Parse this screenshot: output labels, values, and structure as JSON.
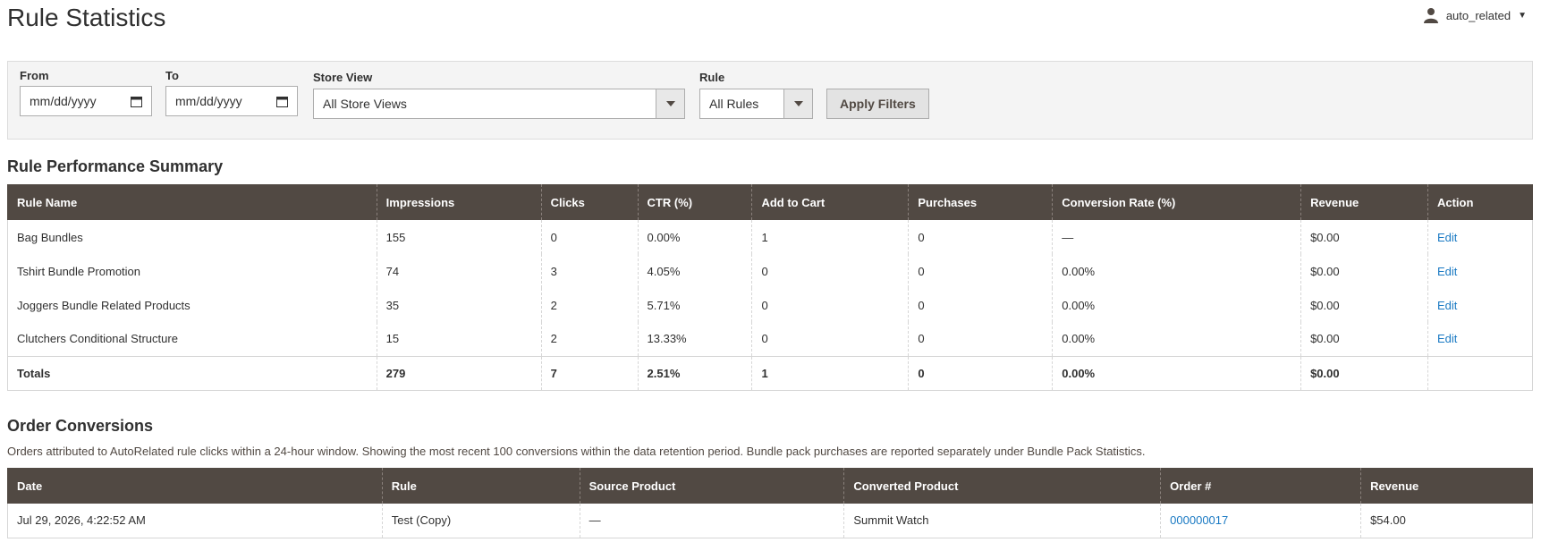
{
  "header": {
    "title": "Rule Statistics",
    "account": {
      "username": "auto_related",
      "icon": "user-icon"
    }
  },
  "filters": {
    "from": {
      "label": "From",
      "placeholder": "mm/dd/yyyy"
    },
    "to": {
      "label": "To",
      "placeholder": "mm/dd/yyyy"
    },
    "store_view": {
      "label": "Store View",
      "value": "All Store Views"
    },
    "rule": {
      "label": "Rule",
      "value": "All Rules"
    },
    "apply_label": "Apply Filters"
  },
  "summary": {
    "title": "Rule Performance Summary",
    "columns": [
      "Rule Name",
      "Impressions",
      "Clicks",
      "CTR (%)",
      "Add to Cart",
      "Purchases",
      "Conversion Rate (%)",
      "Revenue",
      "Action"
    ],
    "rows": [
      {
        "name": "Bag Bundles",
        "impressions": "155",
        "clicks": "0",
        "ctr": "0.00%",
        "add_to_cart": "1",
        "purchases": "0",
        "conversion": "—",
        "revenue": "$0.00",
        "action": "Edit"
      },
      {
        "name": "Tshirt Bundle Promotion",
        "impressions": "74",
        "clicks": "3",
        "ctr": "4.05%",
        "add_to_cart": "0",
        "purchases": "0",
        "conversion": "0.00%",
        "revenue": "$0.00",
        "action": "Edit"
      },
      {
        "name": "Joggers Bundle Related Products",
        "impressions": "35",
        "clicks": "2",
        "ctr": "5.71%",
        "add_to_cart": "0",
        "purchases": "0",
        "conversion": "0.00%",
        "revenue": "$0.00",
        "action": "Edit"
      },
      {
        "name": "Clutchers Conditional Structure",
        "impressions": "15",
        "clicks": "2",
        "ctr": "13.33%",
        "add_to_cart": "0",
        "purchases": "0",
        "conversion": "0.00%",
        "revenue": "$0.00",
        "action": "Edit"
      }
    ],
    "totals": {
      "label": "Totals",
      "impressions": "279",
      "clicks": "7",
      "ctr": "2.51%",
      "add_to_cart": "1",
      "purchases": "0",
      "conversion": "0.00%",
      "revenue": "$0.00"
    }
  },
  "conversions": {
    "title": "Order Conversions",
    "note": "Orders attributed to AutoRelated rule clicks within a 24-hour window. Showing the most recent 100 conversions within the data retention period. Bundle pack purchases are reported separately under Bundle Pack Statistics.",
    "columns": [
      "Date",
      "Rule",
      "Source Product",
      "Converted Product",
      "Order #",
      "Revenue"
    ],
    "rows": [
      {
        "date": "Jul 29, 2026, 4:22:52 AM",
        "rule": "Test (Copy)",
        "source": "—",
        "converted": "Summit Watch",
        "order": "000000017",
        "revenue": "$54.00"
      }
    ]
  },
  "colors": {
    "header_bg": "#514943",
    "link": "#1979c3",
    "filter_bg": "#f4f4f4"
  }
}
